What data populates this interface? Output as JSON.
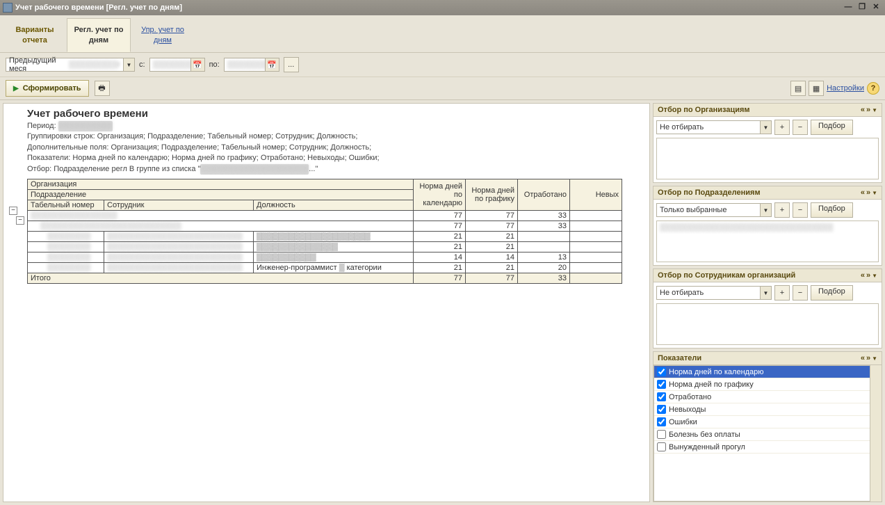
{
  "window": {
    "title": "Учет рабочего времени [Регл. учет по дням]"
  },
  "tabs": {
    "variants": "Варианты отчета",
    "regl": "Регл. учет по дням",
    "upr": "Упр. учет по дням"
  },
  "toolbar1": {
    "prev_month_label": "Предыдущий меся",
    "prev_month_value": "▒▒▒▒▒▒▒▒▒г",
    "from_label": "с:",
    "to_label": "по:",
    "from_value": "▒▒▒▒▒▒▒▒",
    "to_value": "▒▒▒▒▒▒▒▒",
    "dots": "..."
  },
  "toolbar2": {
    "generate": "Сформировать",
    "settings": "Настройки"
  },
  "report": {
    "title": "Учет рабочего времени",
    "period_label": "Период:",
    "period_value": "▒▒▒▒▒▒▒▒▒▒",
    "meta1": "Группировки строк: Организация; Подразделение; Табельный номер; Сотрудник; Должность;",
    "meta2": "Дополнительные поля: Организация; Подразделение; Табельный номер; Сотрудник; Должность;",
    "meta3": "Показатели: Норма дней по календарю; Норма дней по графику; Отработано; Невыходы; Ошибки;",
    "meta4_prefix": "Отбор: Подразделение регл В группе из списка \"",
    "meta4_blur": "▒▒▒▒▒▒▒▒▒▒▒▒▒▒▒▒▒▒▒▒",
    "meta4_suffix": "...\"",
    "headers": {
      "org": "Организация",
      "dept": "Подразделение",
      "tabnum": "Табельный номер",
      "employee": "Сотрудник",
      "position": "Должность",
      "norm_cal": "Норма дней по календарю",
      "norm_sched": "Норма дней по графику",
      "worked": "Отработано",
      "absent": "Невых"
    },
    "org_row": {
      "name": "▒▒▒▒▒▒▒▒▒▒▒▒▒▒▒▒",
      "norm_cal": "77",
      "norm_sched": "77",
      "worked": "33",
      "absent": ""
    },
    "dept_row": {
      "name": "▒▒▒▒▒▒▒▒▒▒▒▒▒▒▒▒▒▒▒▒▒▒▒▒▒▒",
      "norm_cal": "77",
      "norm_sched": "77",
      "worked": "33",
      "absent": ""
    },
    "rows": [
      {
        "tabnum": "▒▒▒▒▒▒▒▒",
        "employee": "▒▒▒▒▒▒▒▒▒▒▒▒▒▒▒▒▒▒▒▒▒▒▒▒▒",
        "position": "▒▒▒▒▒▒▒▒▒▒▒▒▒▒▒▒▒▒▒▒▒",
        "norm_cal": "21",
        "norm_sched": "21",
        "worked": "",
        "absent": ""
      },
      {
        "tabnum": "▒▒▒▒▒▒▒▒",
        "employee": "▒▒▒▒▒▒▒▒▒▒▒▒▒▒▒▒▒▒▒▒▒▒▒▒▒",
        "position": "▒▒▒▒▒▒▒▒▒▒▒▒▒▒▒",
        "norm_cal": "21",
        "norm_sched": "21",
        "worked": "",
        "absent": ""
      },
      {
        "tabnum": "▒▒▒▒▒▒▒▒",
        "employee": "▒▒▒▒▒▒▒▒▒▒▒▒▒▒▒▒▒▒▒▒▒▒▒▒▒",
        "position": "▒▒▒▒▒▒▒▒▒▒▒",
        "norm_cal": "14",
        "norm_sched": "14",
        "worked": "13",
        "absent": ""
      },
      {
        "tabnum": "▒▒▒▒▒▒▒▒",
        "employee": "▒▒▒▒▒▒▒▒▒▒▒▒▒▒▒▒▒▒▒▒▒▒▒▒▒",
        "position": "Инженер-программист ▒ категории",
        "norm_cal": "21",
        "norm_sched": "21",
        "worked": "20",
        "absent": ""
      }
    ],
    "total_label": "Итого",
    "total": {
      "norm_cal": "77",
      "norm_sched": "77",
      "worked": "33",
      "absent": ""
    }
  },
  "filters": {
    "org": {
      "title": "Отбор по Организациям",
      "mode": "Не отбирать",
      "select_btn": "Подбор"
    },
    "dept": {
      "title": "Отбор по Подразделениям",
      "mode": "Только выбранные",
      "select_btn": "Подбор",
      "item0": "▒▒▒▒▒▒▒▒▒▒▒▒▒▒▒▒▒▒▒▒▒▒▒▒▒▒▒▒▒▒▒▒"
    },
    "emp": {
      "title": "Отбор по Сотрудникам организаций",
      "mode": "Не отбирать",
      "select_btn": "Подбор"
    },
    "indicators": {
      "title": "Показатели",
      "items": [
        {
          "label": "Норма дней по календарю",
          "checked": true,
          "selected": true
        },
        {
          "label": "Норма дней по графику",
          "checked": true,
          "selected": false
        },
        {
          "label": "Отработано",
          "checked": true,
          "selected": false
        },
        {
          "label": "Невыходы",
          "checked": true,
          "selected": false
        },
        {
          "label": "Ошибки",
          "checked": true,
          "selected": false
        },
        {
          "label": "Болезнь без оплаты",
          "checked": false,
          "selected": false
        },
        {
          "label": "Вынужденный прогул",
          "checked": false,
          "selected": false
        }
      ]
    }
  }
}
